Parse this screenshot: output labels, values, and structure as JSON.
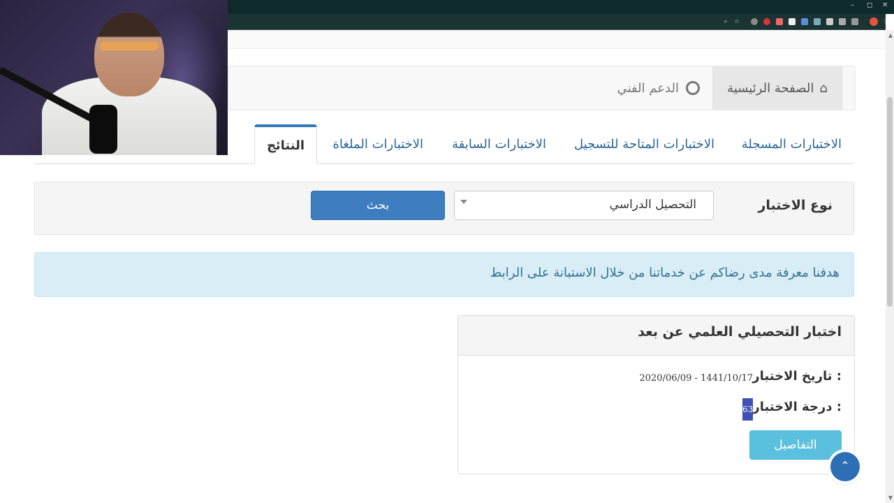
{
  "browser": {
    "window_controls": [
      "–",
      "◻",
      "✕"
    ]
  },
  "nav": {
    "home_label": "الصفحة الرئيسية",
    "support_label": "الدعم الفني"
  },
  "tabs": [
    {
      "label": "الاختبارات المسجلة",
      "active": false
    },
    {
      "label": "الاختبارات المتاحة للتسجيل",
      "active": false
    },
    {
      "label": "الاختبارات السابقة",
      "active": false
    },
    {
      "label": "الاختبارات الملغاة",
      "active": false
    },
    {
      "label": "النتائج",
      "active": true
    }
  ],
  "search": {
    "label": "نوع الاختبار",
    "selected": "التحصيل الدراسي",
    "button": "بحث"
  },
  "alert": {
    "text": "هدفنا معرفة مدى رضاكم عن خدماتنا من خلال الاستبانة على الرابط"
  },
  "result_card": {
    "title": "اختبار التحصيلي العلمي عن بعد",
    "date_label": "تاريخ الاختبار :",
    "date_value": "2020/06/09 - 1441/10/17",
    "score_label": "درجة الاختبار :",
    "score_value": "63",
    "details_button": "التفاصيل"
  },
  "colors": {
    "primary": "#3e7dc0",
    "info": "#5bc0de",
    "alert_bg": "#d9edf7",
    "link": "#2a6496"
  },
  "icons": {
    "home": "home-icon",
    "support": "lifebuoy-icon",
    "to_top": "chevron-up-icon"
  }
}
